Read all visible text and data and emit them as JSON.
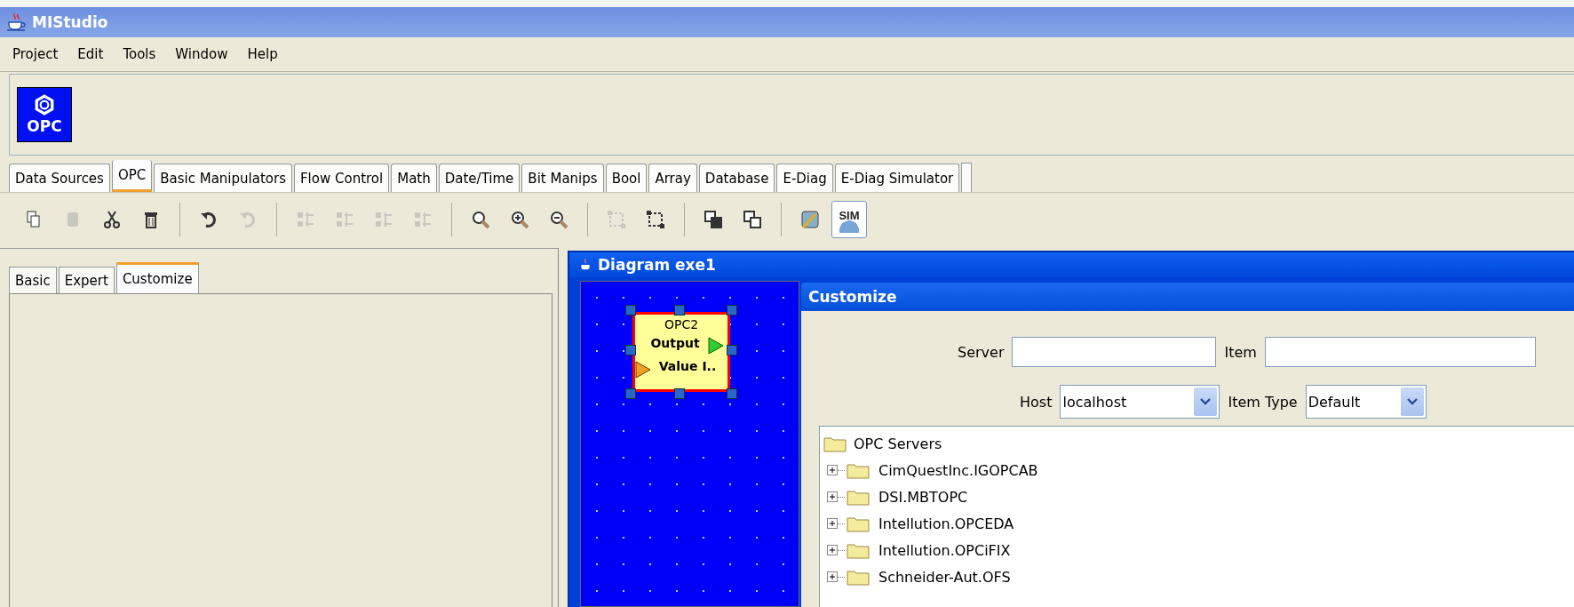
{
  "window": {
    "title": "MIStudio"
  },
  "menu": [
    "Project",
    "Edit",
    "Tools",
    "Window",
    "Help"
  ],
  "palette": [
    {
      "label": "OPC"
    }
  ],
  "tabs": [
    {
      "label": "Data Sources",
      "selected": false
    },
    {
      "label": "OPC",
      "selected": true
    },
    {
      "label": "Basic Manipulators",
      "selected": false
    },
    {
      "label": "Flow Control",
      "selected": false
    },
    {
      "label": "Math",
      "selected": false
    },
    {
      "label": "Date/Time",
      "selected": false
    },
    {
      "label": "Bit Manips",
      "selected": false
    },
    {
      "label": "Bool",
      "selected": false
    },
    {
      "label": "Array",
      "selected": false
    },
    {
      "label": "Database",
      "selected": false
    },
    {
      "label": "E-Diag",
      "selected": false
    },
    {
      "label": "E-Diag Simulator",
      "selected": false
    }
  ],
  "toolbar": [
    [
      {
        "disabled": false
      },
      {
        "disabled": true
      },
      {
        "disabled": false
      },
      {
        "disabled": false
      }
    ],
    [
      {
        "disabled": false
      },
      {
        "disabled": true
      }
    ],
    [
      {
        "disabled": true
      },
      {
        "disabled": true
      },
      {
        "disabled": true
      },
      {
        "disabled": true
      }
    ],
    [
      {
        "disabled": false
      },
      {
        "disabled": false
      },
      {
        "disabled": false
      }
    ],
    [
      {
        "disabled": true
      },
      {
        "disabled": false
      }
    ],
    [
      {
        "disabled": false
      },
      {
        "disabled": false
      }
    ],
    [
      {
        "disabled": false
      },
      {
        "disabled": false,
        "label": "SIM",
        "selected": true
      }
    ]
  ],
  "side_tabs": [
    {
      "label": "Basic",
      "selected": false
    },
    {
      "label": "Expert",
      "selected": false
    },
    {
      "label": "Customize",
      "selected": true
    }
  ],
  "diagram": {
    "title": "Diagram exe1",
    "node": {
      "title": "OPC2",
      "output": "Output",
      "input": "Value I..",
      "selected": true
    }
  },
  "customize": {
    "title": "Customize",
    "server": {
      "label": "Server"
    },
    "item": {
      "label": "Item"
    },
    "host": {
      "label": "Host",
      "value": "localhost"
    },
    "item_type": {
      "label": "Item Type",
      "value": "Default"
    },
    "tree": {
      "label": "OPC Servers",
      "children": [
        {
          "label": "CimQuestInc.IGOPCAB",
          "expanded": false
        },
        {
          "label": "DSI.MBTOPC",
          "expanded": false
        },
        {
          "label": "Intellution.OPCEDA",
          "expanded": false
        },
        {
          "label": "Intellution.OPCiFIX",
          "expanded": false
        },
        {
          "label": "Schneider-Aut.OFS",
          "expanded": false
        }
      ]
    }
  }
}
